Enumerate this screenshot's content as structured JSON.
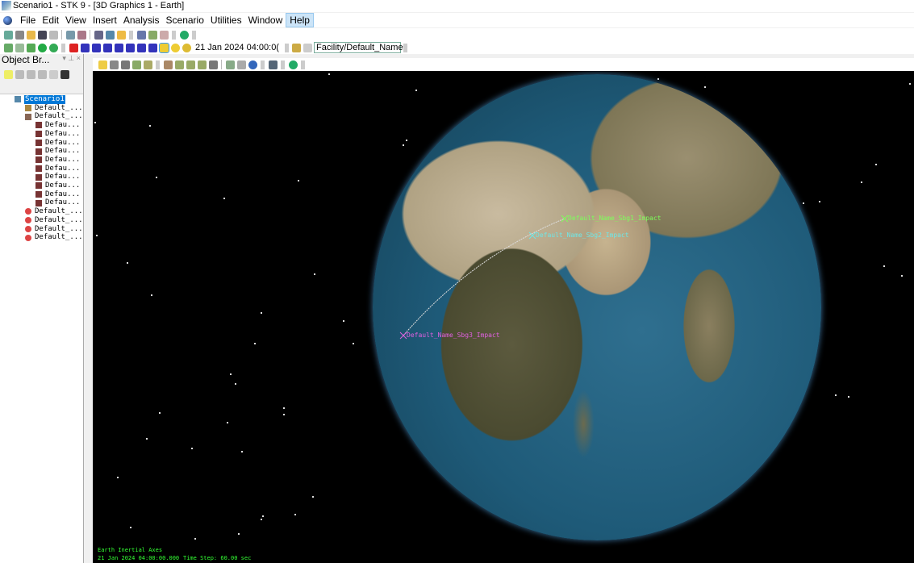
{
  "window": {
    "title": "Scenario1 - STK 9 - [3D Graphics 1 - Earth]"
  },
  "menu": [
    "File",
    "Edit",
    "View",
    "Insert",
    "Analysis",
    "Scenario",
    "Utilities",
    "Window",
    "Help"
  ],
  "toolbar": {
    "time": "21 Jan 2024 04:00:0(",
    "object_combo": "Facility/Default_Name"
  },
  "object_browser": {
    "title": "Object Br...",
    "items": [
      {
        "label": "Scenario1",
        "icon": "scenario-icon",
        "level": 0,
        "selected": true
      },
      {
        "label": "Default_...",
        "icon": "facility-icon",
        "level": 1
      },
      {
        "label": "Default_...",
        "icon": "missile-group-icon",
        "level": 1
      },
      {
        "label": "Defau...",
        "icon": "missile-icon",
        "level": 2
      },
      {
        "label": "Defau...",
        "icon": "missile-icon",
        "level": 2
      },
      {
        "label": "Defau...",
        "icon": "missile-icon",
        "level": 2
      },
      {
        "label": "Defau...",
        "icon": "missile-icon",
        "level": 2
      },
      {
        "label": "Defau...",
        "icon": "missile-icon",
        "level": 2
      },
      {
        "label": "Defau...",
        "icon": "missile-icon",
        "level": 2
      },
      {
        "label": "Defau...",
        "icon": "missile-icon",
        "level": 2
      },
      {
        "label": "Defau...",
        "icon": "missile-icon",
        "level": 2
      },
      {
        "label": "Defau...",
        "icon": "missile-icon",
        "level": 2
      },
      {
        "label": "Defau...",
        "icon": "missile-icon",
        "level": 2
      },
      {
        "label": "Default_...",
        "icon": "target-icon",
        "level": 1
      },
      {
        "label": "Default_...",
        "icon": "target-icon",
        "level": 1
      },
      {
        "label": "Default_...",
        "icon": "target-icon",
        "level": 1
      },
      {
        "label": "Default_...",
        "icon": "target-icon",
        "level": 1
      }
    ]
  },
  "view": {
    "labels": [
      {
        "text": "Default_Name_Sbg1_Impact",
        "color": "#7cff5a"
      },
      {
        "text": "Default_Name_Sbg2_Impact",
        "color": "#6fe6e6"
      },
      {
        "text": "Default_Name_Sbg3_Impact",
        "color": "#e060e0"
      }
    ],
    "axes": "Earth Inertial Axes",
    "time": "21 Jan 2024 04:00:00.000",
    "time_step": "Time Step: 60.00 sec"
  }
}
